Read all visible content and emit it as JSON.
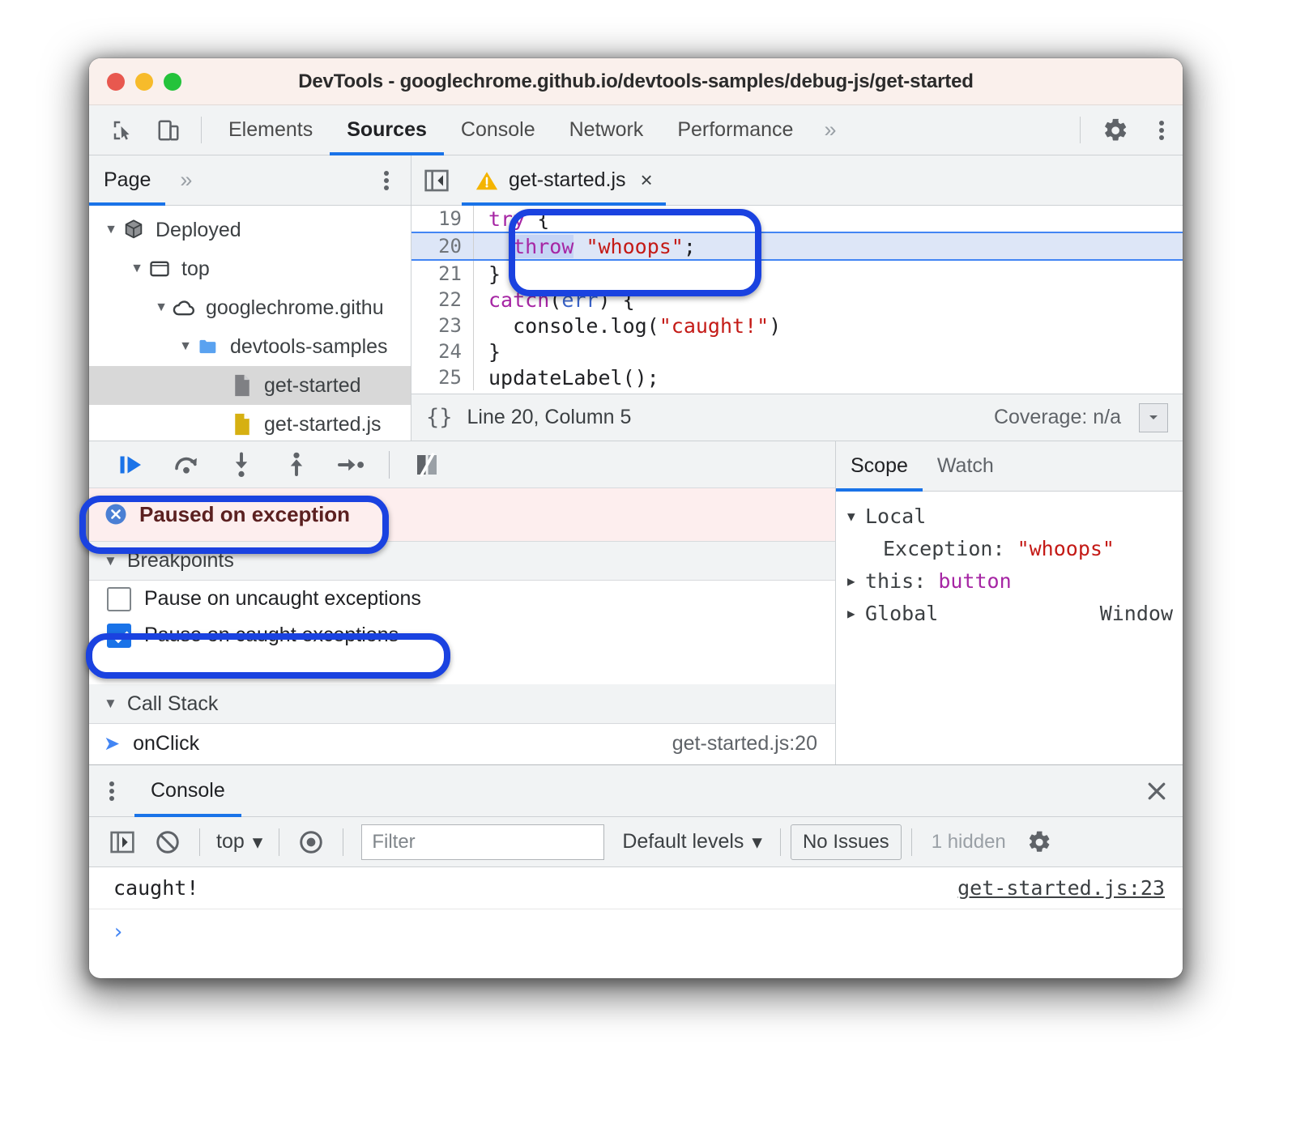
{
  "window": {
    "title": "DevTools - googlechrome.github.io/devtools-samples/debug-js/get-started",
    "traffic": [
      "close",
      "minimize",
      "maximize"
    ]
  },
  "main_toolbar": {
    "icons": [
      "inspect-element-icon",
      "device-toolbar-icon"
    ],
    "tabs": [
      {
        "label": "Elements",
        "active": false
      },
      {
        "label": "Sources",
        "active": true
      },
      {
        "label": "Console",
        "active": false
      },
      {
        "label": "Network",
        "active": false
      },
      {
        "label": "Performance",
        "active": false
      }
    ],
    "more_tabs": "»",
    "settings": "gear-icon",
    "menu": "kebab-icon"
  },
  "navigator": {
    "tabs": [
      {
        "label": "Page",
        "active": true
      },
      {
        "label": "»",
        "active": false
      }
    ],
    "menu": "kebab-icon",
    "tree": [
      {
        "label": "Deployed",
        "icon": "package-icon",
        "indent": 0,
        "expanded": true,
        "selected": false
      },
      {
        "label": "top",
        "icon": "frame-icon",
        "indent": 1,
        "expanded": true,
        "selected": false
      },
      {
        "label": "googlechrome.githu",
        "icon": "cloud-icon",
        "indent": 2,
        "expanded": true,
        "selected": false
      },
      {
        "label": "devtools-samples",
        "icon": "folder-icon",
        "indent": 3,
        "expanded": true,
        "selected": false
      },
      {
        "label": "get-started",
        "icon": "document-icon",
        "indent": 4,
        "expanded": null,
        "selected": true
      },
      {
        "label": "get-started.js",
        "icon": "js-file-icon",
        "indent": 4,
        "expanded": null,
        "selected": false
      }
    ]
  },
  "editor": {
    "panel_toggle": "collapse-sidebar-icon",
    "tab": {
      "label": "get-started.js",
      "warning": "warning-icon",
      "close": "×"
    },
    "lines": [
      {
        "num": "19",
        "tokens": [
          {
            "t": "try",
            "c": "k"
          },
          {
            "t": " {",
            "c": ""
          }
        ],
        "highlight": false
      },
      {
        "num": "20",
        "tokens": [
          {
            "t": "  ",
            "c": ""
          },
          {
            "t": "throw",
            "c": "k sel"
          },
          {
            "t": " ",
            "c": ""
          },
          {
            "t": "\"whoops\"",
            "c": "str"
          },
          {
            "t": ";",
            "c": ""
          }
        ],
        "highlight": true
      },
      {
        "num": "21",
        "tokens": [
          {
            "t": "}",
            "c": ""
          }
        ],
        "highlight": false
      },
      {
        "num": "22",
        "tokens": [
          {
            "t": "catch",
            "c": "k"
          },
          {
            "t": "(",
            "c": ""
          },
          {
            "t": "err",
            "c": "param"
          },
          {
            "t": ") {",
            "c": ""
          }
        ],
        "highlight": false
      },
      {
        "num": "23",
        "tokens": [
          {
            "t": "  console.log(",
            "c": ""
          },
          {
            "t": "\"caught!\"",
            "c": "str"
          },
          {
            "t": ")",
            "c": ""
          }
        ],
        "highlight": false
      },
      {
        "num": "24",
        "tokens": [
          {
            "t": "}",
            "c": ""
          }
        ],
        "highlight": false
      },
      {
        "num": "25",
        "tokens": [
          {
            "t": "updateLabel();",
            "c": ""
          }
        ],
        "highlight": false
      }
    ],
    "status": {
      "format_button": "{}",
      "position": "Line 20, Column 5",
      "coverage": "Coverage: n/a",
      "drawer_toggle": "show-drawer-icon"
    }
  },
  "debugger": {
    "toolbar": [
      {
        "name": "resume-button",
        "title": "Resume script execution"
      },
      {
        "name": "step-over-button",
        "title": "Step over next function call"
      },
      {
        "name": "step-into-button",
        "title": "Step into next function call"
      },
      {
        "name": "step-out-button",
        "title": "Step out of current function"
      },
      {
        "name": "step-button",
        "title": "Step"
      },
      {
        "name": "deactivate-breakpoints-button",
        "title": "Deactivate breakpoints"
      }
    ],
    "paused_message": "Paused on exception",
    "paused_icon": "error-circle-icon",
    "sections": {
      "breakpoints": "Breakpoints",
      "call_stack": "Call Stack"
    },
    "checkboxes": [
      {
        "label": "Pause on uncaught exceptions",
        "checked": false
      },
      {
        "label": "Pause on caught exceptions",
        "checked": true
      }
    ],
    "call_stack": [
      {
        "name": "onClick",
        "location": "get-started.js:20",
        "current": true
      }
    ]
  },
  "scope": {
    "tabs": [
      {
        "label": "Scope",
        "active": true
      },
      {
        "label": "Watch",
        "active": false
      }
    ],
    "rows": [
      {
        "caret": "▼",
        "name": "Local",
        "sep": "",
        "value": "",
        "right": "",
        "indent": 0
      },
      {
        "caret": "",
        "name": "Exception:",
        "sep": " ",
        "value": "\"whoops\"",
        "value_class": "sred",
        "right": "",
        "indent": 1
      },
      {
        "caret": "▶",
        "name": "this:",
        "sep": " ",
        "value": "button",
        "value_class": "spurple",
        "right": "",
        "indent": 0
      },
      {
        "caret": "▶",
        "name": "Global",
        "sep": "",
        "value": "",
        "right": "Window",
        "indent": 0
      }
    ]
  },
  "drawer": {
    "menu": "kebab-icon",
    "tab": "Console",
    "close": "close-icon",
    "toolbar": {
      "sidebar_toggle": "console-sidebar-icon",
      "clear": "clear-console-icon",
      "context": "top",
      "context_caret": "▾",
      "eye": "live-expression-icon",
      "filter_placeholder": "Filter",
      "filter_value": "",
      "levels": "Default levels",
      "levels_caret": "▾",
      "issues": "No Issues",
      "hidden": "1 hidden",
      "settings": "gear-icon"
    },
    "messages": [
      {
        "text": "caught!",
        "source": "get-started.js:23"
      }
    ],
    "prompt": "›"
  },
  "annotations": {
    "accent_color": "#1a42e0",
    "highlights": [
      "try-throw-block",
      "paused-on-exception",
      "pause-on-caught-exceptions"
    ]
  },
  "colors": {
    "titlebar_bg": "#faf0ec",
    "toolbar_bg": "#f1f3f4",
    "accent_blue": "#1a73e8",
    "paused_bg": "#fdeeee",
    "paused_text": "#5b2020",
    "exec_line_bg": "#dde6f7",
    "string_red": "#c41a16",
    "keyword_purple": "#a626a4"
  }
}
